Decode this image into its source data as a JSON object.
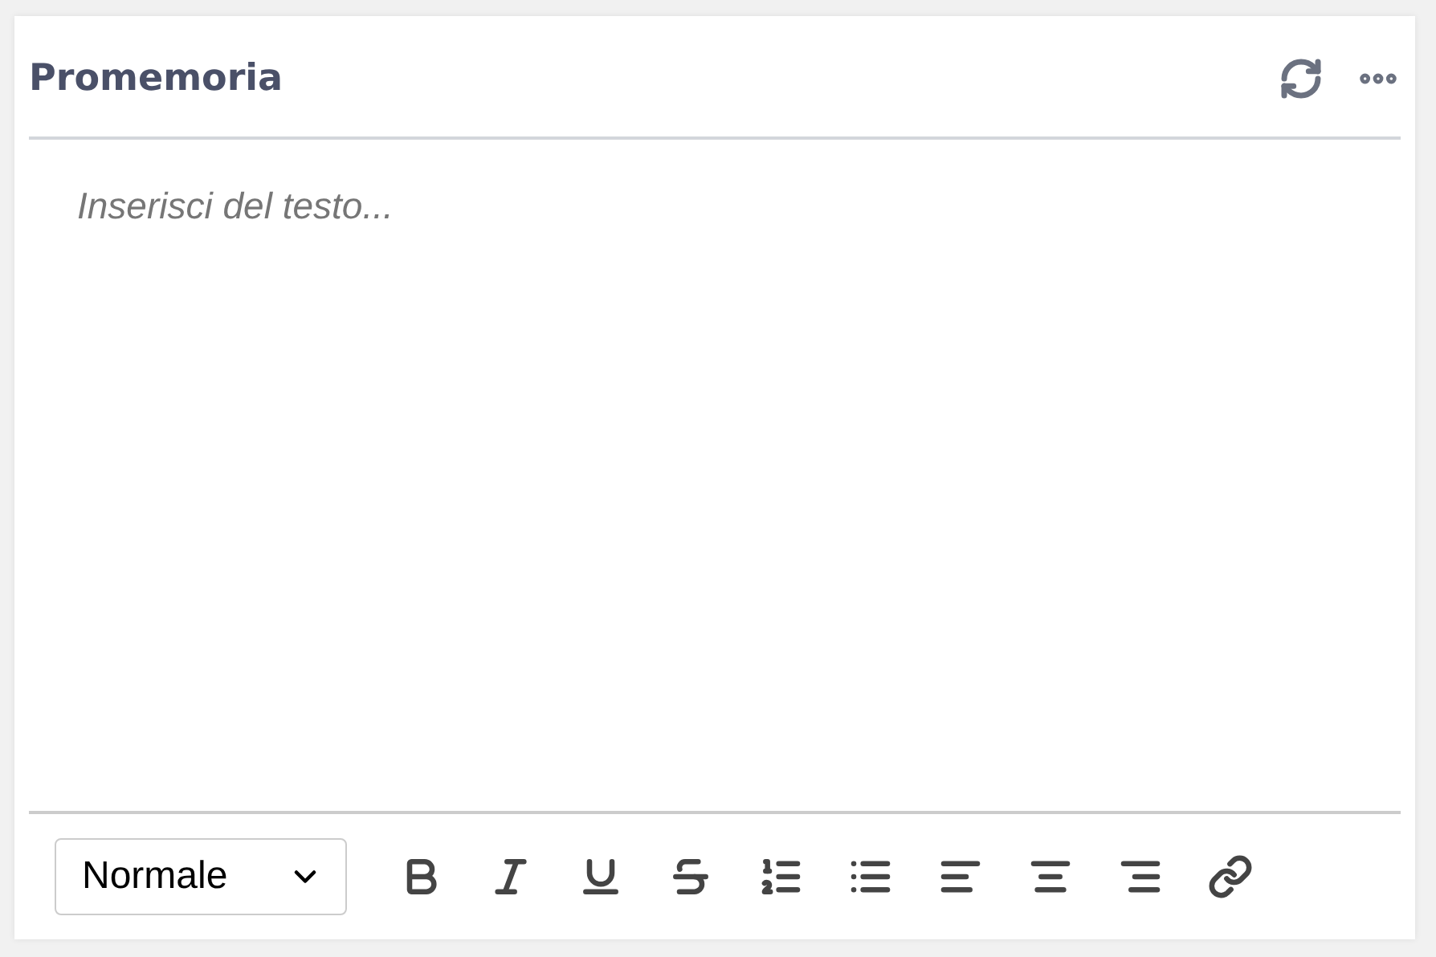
{
  "widget": {
    "title": "Promemoria"
  },
  "editor": {
    "placeholder": "Inserisci del testo..."
  },
  "toolbar": {
    "format": {
      "value": "Normale"
    },
    "buttons": [
      {
        "kind": "bold"
      },
      {
        "kind": "italic"
      },
      {
        "kind": "underline"
      },
      {
        "kind": "strike"
      },
      {
        "kind": "ordered-list"
      },
      {
        "kind": "bullet-list"
      },
      {
        "kind": "align-left"
      },
      {
        "kind": "align-center"
      },
      {
        "kind": "align-right"
      },
      {
        "kind": "link"
      }
    ]
  }
}
